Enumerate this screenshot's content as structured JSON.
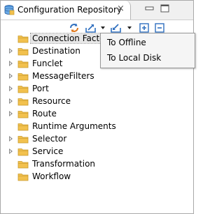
{
  "view": {
    "title": "Configuration Repository",
    "close_glyph": "×"
  },
  "toolbar": {
    "buttons": [
      {
        "icon": "refresh-icon"
      },
      {
        "icon": "export-icon"
      },
      {
        "icon": "import-icon"
      },
      {
        "icon": "expand-all-icon"
      },
      {
        "icon": "collapse-all-icon"
      }
    ]
  },
  "tree": {
    "items": [
      {
        "label": "Connection Factory",
        "expandable": false,
        "selected": true
      },
      {
        "label": "Destination",
        "expandable": true
      },
      {
        "label": "Funclet",
        "expandable": true
      },
      {
        "label": "MessageFilters",
        "expandable": true
      },
      {
        "label": "Port",
        "expandable": true
      },
      {
        "label": "Resource",
        "expandable": true
      },
      {
        "label": "Route",
        "expandable": true
      },
      {
        "label": "Runtime Arguments",
        "expandable": false
      },
      {
        "label": "Selector",
        "expandable": true
      },
      {
        "label": "Service",
        "expandable": true
      },
      {
        "label": "Transformation",
        "expandable": false
      },
      {
        "label": "Workflow",
        "expandable": false
      }
    ]
  },
  "menu": {
    "items": [
      {
        "label": "To Offline"
      },
      {
        "label": "To Local Disk"
      }
    ]
  },
  "colors": {
    "folder": "#f2c14e",
    "folder_edge": "#c89a2c",
    "accent_blue": "#2f6fbf"
  }
}
